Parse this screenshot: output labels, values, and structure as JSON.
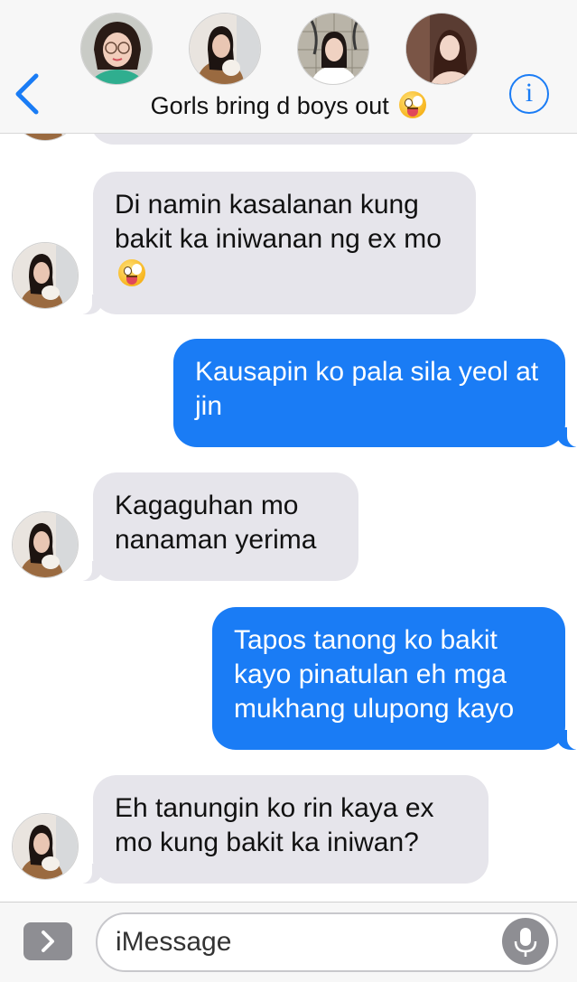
{
  "header": {
    "group_name": "Gorls bring d boys out",
    "title_emoji": "zany-face-emoji",
    "back_icon": "chevron-left-icon",
    "info_icon": "info-icon",
    "info_glyph": "i",
    "accent_color": "#1a7cf5"
  },
  "messages": [
    {
      "direction": "incoming",
      "text": "Di namin kasalanan kung bakit ka iniwanan ng ex mo",
      "emoji": "zany-face-emoji"
    },
    {
      "direction": "outgoing",
      "text": "Kausapin ko pala sila yeol at jin"
    },
    {
      "direction": "incoming",
      "text": "Kagaguhan mo nanaman yerima"
    },
    {
      "direction": "outgoing",
      "text": "Tapos tanong ko bakit kayo pinatulan eh mga mukhang ulupong kayo"
    },
    {
      "direction": "incoming",
      "text": "Eh tanungin ko rin kaya ex mo kung bakit ka iniwan?"
    }
  ],
  "composer": {
    "placeholder": "iMessage",
    "apps_icon": "chevron-right-icon",
    "mic_icon": "microphone-icon"
  },
  "colors": {
    "outgoing_bubble": "#1a7cf5",
    "incoming_bubble": "#e6e5eb",
    "header_bg": "#f7f7f7"
  }
}
